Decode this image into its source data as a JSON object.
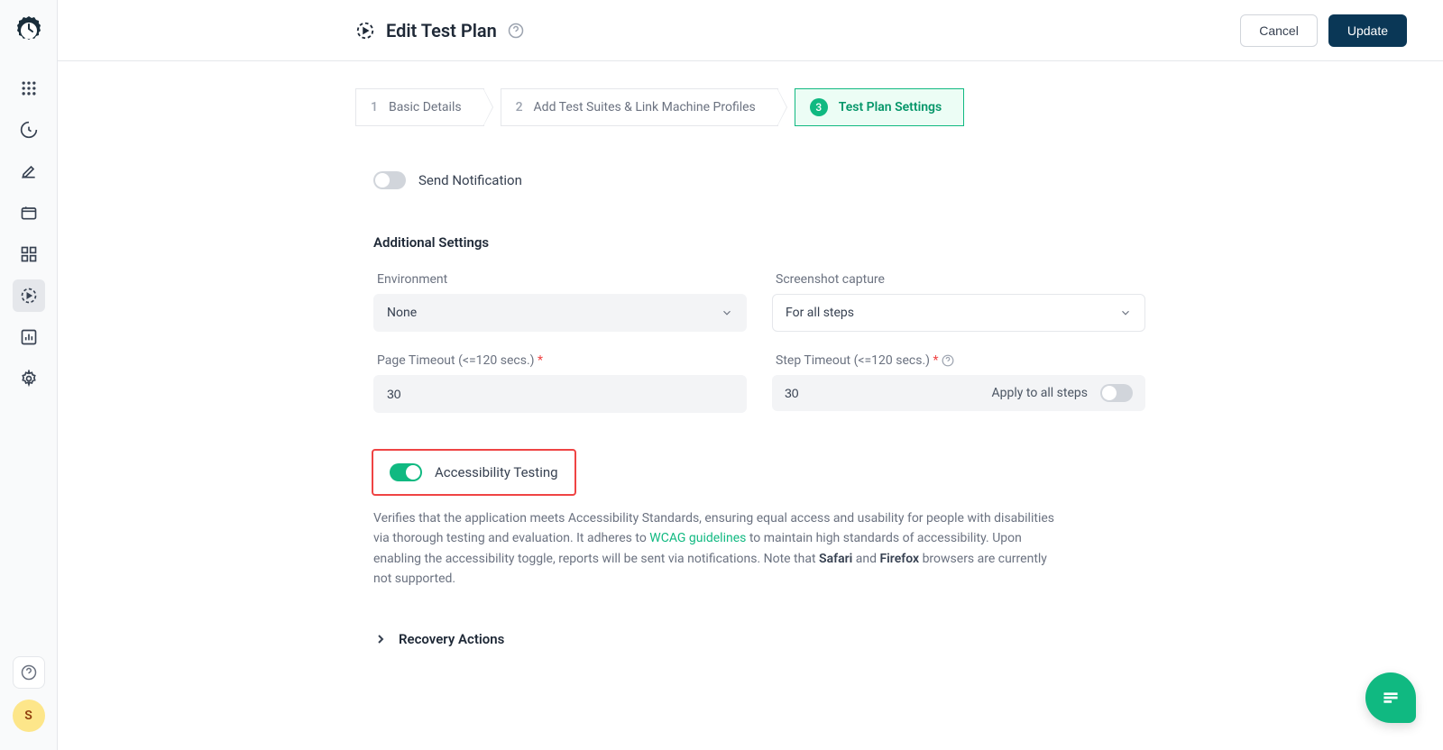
{
  "header": {
    "title": "Edit Test Plan",
    "cancel": "Cancel",
    "update": "Update"
  },
  "steps": [
    {
      "num": "1",
      "label": "Basic Details"
    },
    {
      "num": "2",
      "label": "Add Test Suites & Link Machine Profiles"
    },
    {
      "num": "3",
      "label": "Test Plan Settings"
    }
  ],
  "sendNotification": {
    "label": "Send Notification"
  },
  "additional": {
    "title": "Additional Settings"
  },
  "fields": {
    "environment": {
      "label": "Environment",
      "value": "None"
    },
    "screenshot": {
      "label": "Screenshot capture",
      "value": "For all steps"
    },
    "pageTimeout": {
      "label": "Page Timeout (<=120 secs.)",
      "value": "30"
    },
    "stepTimeout": {
      "label": "Step Timeout (<=120 secs.)",
      "value": "30",
      "applyLabel": "Apply to all steps"
    }
  },
  "accessibility": {
    "label": "Accessibility Testing",
    "desc1": "Verifies that the application meets Accessibility Standards, ensuring equal access and usability for people with disabilities via thorough testing and evaluation. It adheres to ",
    "link": "WCAG guidelines",
    "desc2": " to maintain high standards of accessibility. Upon enabling the accessibility toggle, reports will be sent via notifications. Note that ",
    "browser1": "Safari",
    "desc3": " and ",
    "browser2": "Firefox",
    "desc4": " browsers are currently not supported."
  },
  "recovery": {
    "label": "Recovery Actions"
  },
  "avatar": {
    "initial": "S"
  }
}
